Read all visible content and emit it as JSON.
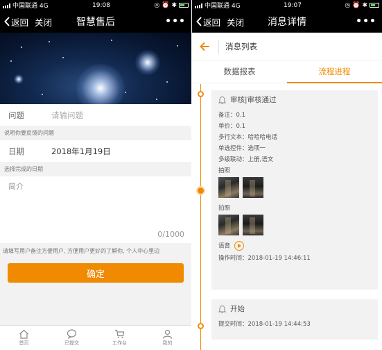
{
  "left": {
    "status": {
      "carrier": "中国联通 4G",
      "time": "19:08"
    },
    "nav": {
      "back": "返回",
      "close": "关闭",
      "title": "智慧售后"
    },
    "form": {
      "question_label": "问题",
      "question_placeholder": "请输问题",
      "question_hint": "说明你要反馈的问题",
      "date_label": "日期",
      "date_value": "2018年1月19日",
      "date_hint": "选择完成的日期",
      "intro_placeholder": "简介",
      "counter": "0/1000",
      "intro_hint": "请填写用户备注方便用户, 方便用户更好的了解你, 个人中心里边",
      "submit": "确定"
    },
    "tabs": [
      "首页",
      "已提交",
      "工作台",
      "我的"
    ]
  },
  "right": {
    "status": {
      "carrier": "中国联通 4G",
      "time": "19:07"
    },
    "nav": {
      "back": "返回",
      "close": "关闭",
      "title": "消息详情"
    },
    "sub_header": "消息列表",
    "tabs": [
      "数据报表",
      "流程进程"
    ],
    "cards": [
      {
        "title": "审核|审核通过",
        "lines": [
          "备注：0.1",
          "单价：0.1",
          "多行文本：哈哈哈电话",
          "单选控件：选项一",
          "多级联动：上册,语文"
        ],
        "photo_label": "拍照",
        "voice_label": "语音",
        "time": "操作时间：2018-01-19 14:46:11"
      },
      {
        "title": "开始",
        "time": "提交时间：2018-01-19 14:44:53"
      }
    ]
  },
  "colors": {
    "accent": "#f08a00",
    "navbar": "#000000",
    "background": "#f2f2f2"
  }
}
